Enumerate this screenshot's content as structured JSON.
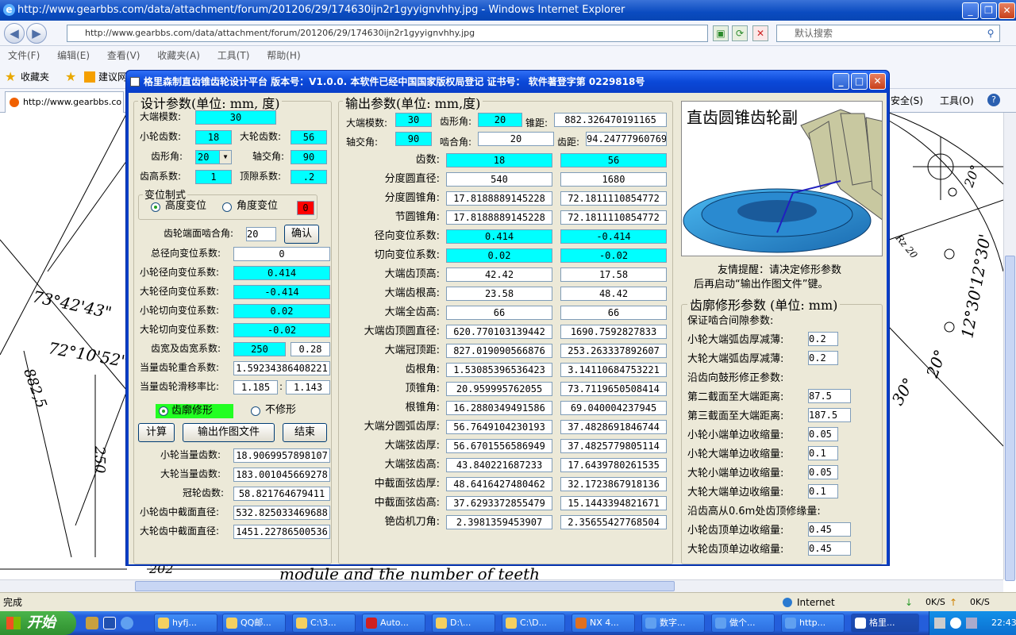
{
  "browser": {
    "title": "http://www.gearbbs.com/data/attachment/forum/201206/29/174630ijn2r1gyyignvhhy.jpg - Windows Internet Explorer",
    "url": "http://www.gearbbs.com/data/attachment/forum/201206/29/174630ijn2r1gyyignvhhy.jpg",
    "search_placeholder": "默认搜索",
    "menus": [
      "文件(F)",
      "编辑(E)",
      "查看(V)",
      "收藏夹(A)",
      "工具(T)",
      "帮助(H)"
    ],
    "favorites_label": "收藏夹",
    "suggest_label": "建议网",
    "tab_label": "http://www.gearbbs.co",
    "right_tools": [
      "安全(S)",
      "工具(O)"
    ],
    "status": "完成",
    "zone": "Internet",
    "net_down": "0K/S",
    "net_up": "0K/S"
  },
  "drawing": {
    "angle1": "73°42'43\"",
    "angle2": "72°10'52\"",
    "dim1": "882,5",
    "dim2": "250",
    "dim3": "202",
    "caption": "module and the number of teeth",
    "r_angle1": "12°30'12°30'",
    "r_angle2": "20°",
    "r_angle3": "30°",
    "r_label": "Rz 20",
    "r_angle4": "20°"
  },
  "app": {
    "title": "格里森制直齿锥齿轮设计平台   版本号：V1.0.0.    本软件已经中国国家版权局登记   证书号：   软件著登字第 0229818号",
    "design": {
      "title": "设计参数(单位: mm, 度)",
      "module_label": "大端模数:",
      "module": "30",
      "z1_label": "小轮齿数:",
      "z1": "18",
      "z2_label": "大轮齿数:",
      "z2": "56",
      "alpha_label": "齿形角:",
      "alpha": "20",
      "sigma_label": "轴交角:",
      "sigma": "90",
      "ha_label": "齿高系数:",
      "ha": "1",
      "c_label": "顶隙系数:",
      "c": ".2",
      "shift_title": "变位制式",
      "shift_h": "高度变位",
      "shift_a": "角度变位",
      "shift_val": "0",
      "end_angle_label": "齿轮端面啮合角:",
      "end_angle": "20",
      "confirm": "确认",
      "total_shift_label": "总径向变位系数:",
      "total_shift": "0",
      "x1_label": "小轮径向变位系数:",
      "x1": "0.414",
      "x2_label": "大轮径向变位系数:",
      "x2": "-0.414",
      "xt1_label": "小轮切向变位系数:",
      "xt1": "0.02",
      "xt2_label": "大轮切向变位系数:",
      "xt2": "-0.02",
      "width_label": "齿宽及齿宽系数:",
      "width": "250",
      "width_coef": "0.28",
      "overlap_label": "当量齿轮重合系数:",
      "overlap": "1.59234386408221",
      "slide_label": "当量齿轮滑移率比:",
      "slide1": "1.185",
      "slide_sep": ":",
      "slide2": "1.143",
      "modify_on": "齿廓修形",
      "modify_off": "不修形",
      "calc_btn": "计算",
      "export_btn": "输出作图文件",
      "exit_btn": "结束",
      "zv1_label": "小轮当量齿数:",
      "zv1": "18.9069957898107",
      "zv2_label": "大轮当量齿数:",
      "zv2": "183.001045669278",
      "zc_label": "冠轮齿数:",
      "zc": "58.821764679411",
      "dm1_label": "小轮齿中截面直径:",
      "dm1": "532.825033469688",
      "dm2_label": "大轮齿中截面直径:",
      "dm2": "1451.22786500536"
    },
    "output": {
      "title": "输出参数(单位: mm,度)",
      "m_label": "大端模数:",
      "m": "30",
      "alpha_label": "齿形角:",
      "alpha": "20",
      "R_label": "锥距:",
      "R": "882.326470191165",
      "sigma_label": "轴交角:",
      "sigma": "90",
      "mesh_label": "啮合角:",
      "mesh": "20",
      "pitch_label": "齿距:",
      "pitch": "94.24777960769",
      "rows": [
        {
          "label": "齿数:",
          "a": "18",
          "b": "56",
          "cyan": true
        },
        {
          "label": "分度圆直径:",
          "a": "540",
          "b": "1680",
          "cyan": false
        },
        {
          "label": "分度圆锥角:",
          "a": "17.8188889145228",
          "b": "72.1811110854772",
          "cyan": false
        },
        {
          "label": "节圆锥角:",
          "a": "17.8188889145228",
          "b": "72.1811110854772",
          "cyan": false
        },
        {
          "label": "径向变位系数:",
          "a": "0.414",
          "b": "-0.414",
          "cyan": true
        },
        {
          "label": "切向变位系数:",
          "a": "0.02",
          "b": "-0.02",
          "cyan": true
        },
        {
          "label": "大端齿顶高:",
          "a": "42.42",
          "b": "17.58",
          "cyan": false
        },
        {
          "label": "大端齿根高:",
          "a": "23.58",
          "b": "48.42",
          "cyan": false
        },
        {
          "label": "大端全齿高:",
          "a": "66",
          "b": "66",
          "cyan": false
        },
        {
          "label": "大端齿顶圆直径:",
          "a": "620.770103139442",
          "b": "1690.7592827833",
          "cyan": false
        },
        {
          "label": "大端冠顶距:",
          "a": "827.019090566876",
          "b": "253.263337892607",
          "cyan": false
        },
        {
          "label": "齿根角:",
          "a": "1.53085396536423",
          "b": "3.14110684753221",
          "cyan": false
        },
        {
          "label": "顶锥角:",
          "a": "20.959995762055",
          "b": "73.7119650508414",
          "cyan": false
        },
        {
          "label": "根锥角:",
          "a": "16.2880349491586",
          "b": "69.040004237945",
          "cyan": false
        },
        {
          "label": "大端分圆弧齿厚:",
          "a": "56.7649104230193",
          "b": "37.4828691846744",
          "cyan": false
        },
        {
          "label": "大端弦齿厚:",
          "a": "56.6701556586949",
          "b": "37.4825779805114",
          "cyan": false
        },
        {
          "label": "大端弦齿高:",
          "a": "43.840221687233",
          "b": "17.6439780261535",
          "cyan": false
        },
        {
          "label": "中截面弦齿厚:",
          "a": "48.6416427480462",
          "b": "32.1723867918136",
          "cyan": false
        },
        {
          "label": "中截面弦齿高:",
          "a": "37.6293372855479",
          "b": "15.1443394821671",
          "cyan": false
        },
        {
          "label": "铯齿机刀角:",
          "a": "2.3981359453907",
          "b": "2.35655427768504",
          "cyan": false
        }
      ]
    },
    "preview": {
      "title": "直齿圆锥齿轮副"
    },
    "reminder": {
      "line1": "友情提醒：请决定修形参数",
      "line2": "后再启动“输出作图文件”键。"
    },
    "mod": {
      "title": "齿廓修形参数 (单位: mm)",
      "guarantee": "保证啮合间隙参数:",
      "r1_label": "小轮大端弧齿厚减薄:",
      "r1": "0.2",
      "r2_label": "大轮大端弧齿厚减薄:",
      "r2": "0.2",
      "crown": "沿齿向鼓形修正参数:",
      "s2_label": "第二截面至大端距离:",
      "s2": "87.5",
      "s3_label": "第三截面至大端距离:",
      "s3": "187.5",
      "p1s_label": "小轮小端单边收缩量:",
      "p1s": "0.05",
      "p1l_label": "小轮大端单边收缩量:",
      "p1l": "0.1",
      "g1s_label": "大轮小端单边收缩量:",
      "g1s": "0.05",
      "g1l_label": "大轮大端单边收缩量:",
      "g1l": "0.1",
      "tip": "沿齿高从0.6m处齿顶修缘量:",
      "t1_label": "小轮齿顶单边收缩量:",
      "t1": "0.45",
      "t2_label": "大轮齿顶单边收缩量:",
      "t2": "0.45"
    }
  },
  "taskbar": {
    "start": "开始",
    "items": [
      "hyfj...",
      "QQ邮...",
      "C:\\3...",
      "Auto...",
      "D:\\...",
      "C:\\D...",
      "NX 4...",
      "数字...",
      "做个...",
      "http...",
      "格里..."
    ],
    "time": "22:43"
  }
}
